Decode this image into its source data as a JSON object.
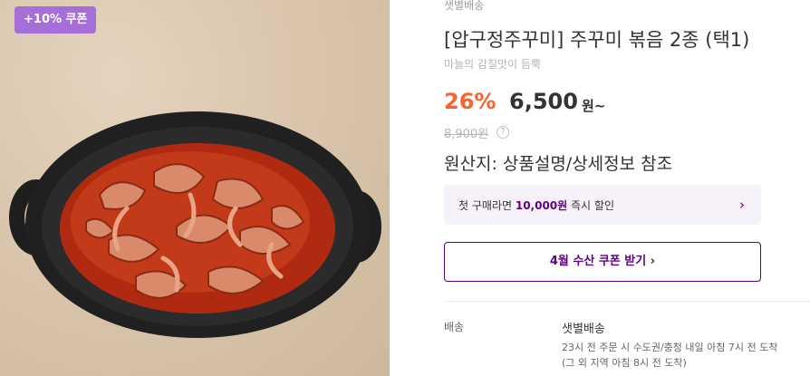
{
  "badge": {
    "coupon_label": "+10% 쿠폰"
  },
  "product": {
    "delivery_type": "샛별배송",
    "title": "[압구정주꾸미] 주꾸미 볶음 2종 (택1)",
    "subtitle": "마늘의 감칠맛이 듬뿍",
    "discount_rate": "26%",
    "price": "6,500",
    "price_unit": "원~",
    "original_price": "8,900원",
    "help_icon": "question-circle-icon",
    "origin": "원산지: 상품설명/상세정보 참조"
  },
  "promo": {
    "first_order_prefix": "첫 구매라면 ",
    "first_order_amount": "10,000원",
    "first_order_suffix": " 즉시 할인",
    "chevron": "›",
    "coupon_button": "4월 수산 쿠폰 받기 ›"
  },
  "shipping": {
    "label": "배송",
    "title": "샛별배송",
    "line1": "23시 전 주문 시 수도권/충청 내일 아침 7시 전 도착",
    "line2": "(그 외 지역 아침 8시 전 도착)"
  },
  "colors": {
    "accent": "#5f0080",
    "discount": "#fa622f",
    "badge": "#a56ed8"
  }
}
